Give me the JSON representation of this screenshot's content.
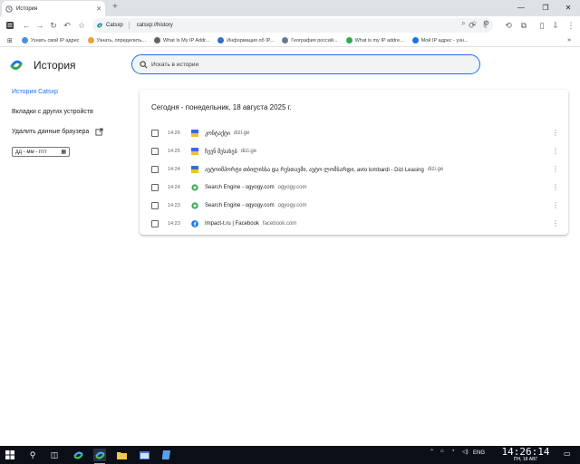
{
  "browser": {
    "tab_title": "История",
    "tab_close": "✕",
    "new_tab": "+",
    "window_controls": [
      "—",
      "❐",
      "✕"
    ],
    "omnibox_site": "Catsxp",
    "omnibox_url": "catsxp://history"
  },
  "bookmarks": [
    {
      "label": "Узнать свой IP адрес",
      "icon_color": "#4a90d9"
    },
    {
      "label": "Узнать, определить...",
      "icon_color": "#e8a33d"
    },
    {
      "label": "What Is My IP Addr...",
      "icon_color": "#5f6368"
    },
    {
      "label": "Информация об IP...",
      "icon_color": "#3b6dc4"
    },
    {
      "label": "География россий...",
      "icon_color": "#6b7a8f"
    },
    {
      "label": "What is my IP addre...",
      "icon_color": "#34a853"
    },
    {
      "label": "Мой IP адрес - узн...",
      "icon_color": "#1a73e8"
    }
  ],
  "sidebar": {
    "title": "История",
    "items": [
      {
        "label": "История Catsxp",
        "active": true
      },
      {
        "label": "Вкладки с других устройств",
        "active": false
      },
      {
        "label": "Удалить данные браузера",
        "active": false
      }
    ],
    "date_placeholder": "дд - мм - гггг"
  },
  "search": {
    "placeholder": "Искать в истории"
  },
  "history": {
    "heading": "Сегодня - понедельник, 18 августа 2025 г.",
    "entries": [
      {
        "time": "14:26",
        "title": "კონტაქტი",
        "domain": "dizi.ge",
        "icon": "dizi-icon"
      },
      {
        "time": "14:25",
        "title": "ჩვენ შესახებ",
        "domain": "dizi.ge",
        "icon": "dizi-icon"
      },
      {
        "time": "14:24",
        "title": "ავტოიმპორტი თბილისსა და რუსთავში, ავტო ლომბარდი, avto lombardi - Dizi Leasing",
        "domain": "dizi.ge",
        "icon": "dizi-icon"
      },
      {
        "time": "14:24",
        "title": "Search Engine - ogyogy.com",
        "domain": "ogyogy.com",
        "icon": "ogyogy-icon"
      },
      {
        "time": "14:23",
        "title": "Search Engine - ogyogy.com",
        "domain": "ogyogy.com",
        "icon": "ogyogy-icon"
      },
      {
        "time": "14:23",
        "title": "Impact-t.ru | Facebook",
        "domain": "facebook.com",
        "icon": "facebook-icon"
      }
    ]
  },
  "taskbar": {
    "language": "ENG",
    "time": "14:26:14",
    "date": "ПН, 18 АВГ"
  },
  "colors": {
    "accent": "#1a73e8",
    "taskbar_bg": "#0b0f18"
  }
}
